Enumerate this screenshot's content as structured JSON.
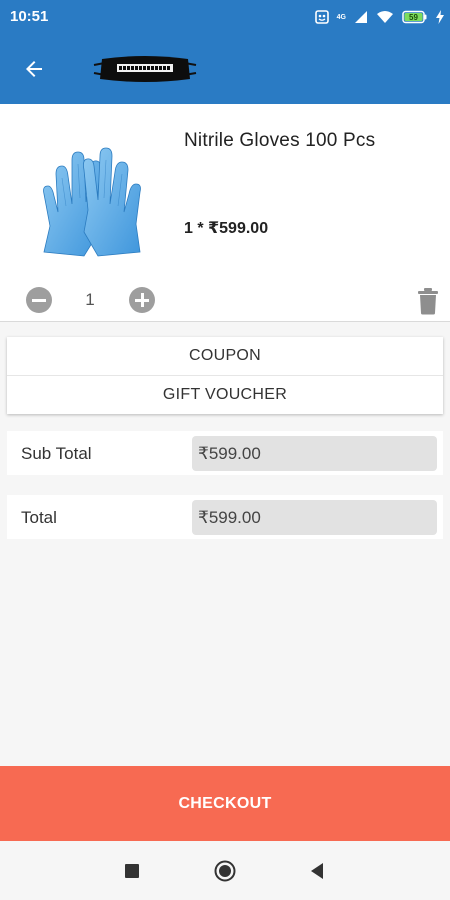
{
  "status_bar": {
    "time": "10:51",
    "network_label": "4G",
    "icons": [
      "notification-icon",
      "signal-icon",
      "wifi-icon",
      "battery-icon",
      "charging-icon"
    ],
    "battery_level_label": "59"
  },
  "app_bar": {
    "background_color": "#2a7bc4",
    "back_icon": "arrow-left-icon",
    "logo": "mask-logo"
  },
  "product": {
    "name": "Nitrile Gloves 100 Pcs",
    "price_line": "1 * ₹599.00",
    "image": "blue-gloves-image",
    "quantity": "1"
  },
  "promo": {
    "coupon_label": "COUPON",
    "gift_voucher_label": "GIFT VOUCHER"
  },
  "totals": {
    "subtotal_label": "Sub Total",
    "subtotal_value": "₹599.00",
    "total_label": "Total",
    "total_value": "₹599.00"
  },
  "checkout": {
    "label": "CHECKOUT",
    "color": "#f76a52"
  },
  "nav_bar": {
    "icons": [
      "recents-icon",
      "home-icon",
      "back-icon"
    ]
  }
}
